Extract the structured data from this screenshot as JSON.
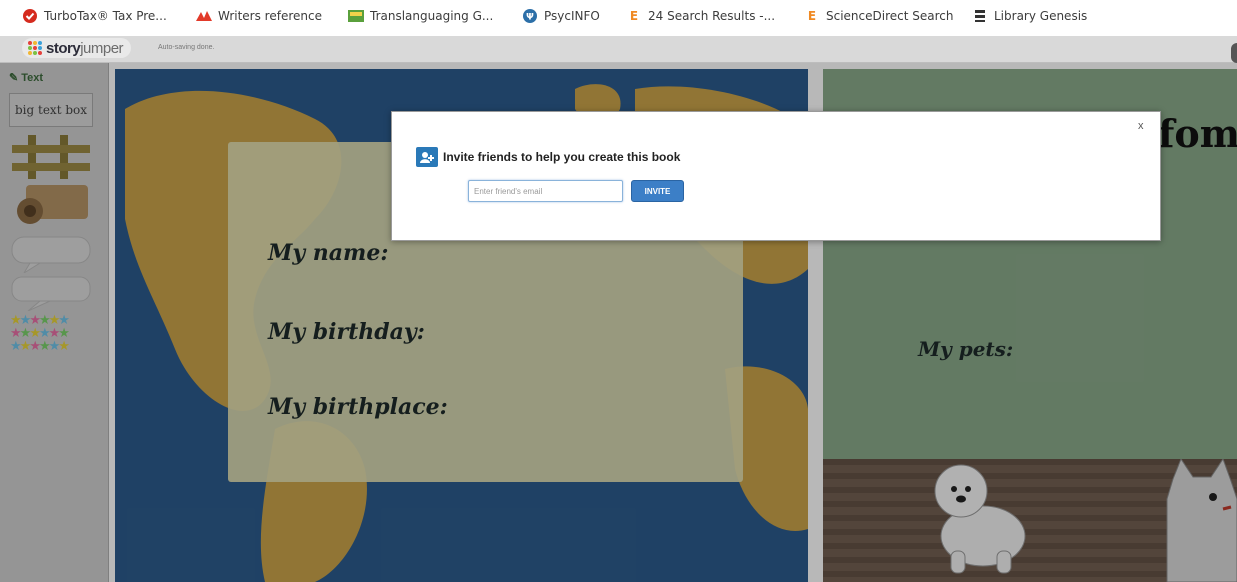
{
  "bookmarks": [
    {
      "label": "TurboTax® Tax Pre...",
      "icon": "turbotax-icon",
      "color": "#d52b1e"
    },
    {
      "label": "Writers reference",
      "icon": "writers-reference-icon",
      "color": "#e23a2a"
    },
    {
      "label": "Translanguaging G...",
      "icon": "image-icon",
      "color": "#5aa03c"
    },
    {
      "label": "PsycINFO",
      "icon": "psycinfo-icon",
      "color": "#2c6fa8"
    },
    {
      "label": "24 Search Results -...",
      "icon": "elsevier-icon",
      "color": "#f08a24"
    },
    {
      "label": "ScienceDirect Search",
      "icon": "elsevier-icon",
      "color": "#f08a24"
    },
    {
      "label": "Library Genesis",
      "icon": "library-genesis-icon",
      "color": "#333333"
    }
  ],
  "app": {
    "logo_bold": "story",
    "logo_light": "jumper",
    "autosave": "Auto-saving done."
  },
  "tools": {
    "title": "Text",
    "sample": "big text box"
  },
  "left_page": {
    "lines": [
      "My name:",
      "My birthday:",
      "My birthplace:"
    ]
  },
  "right_page": {
    "title_fragment": "fome",
    "pets_label": "My pets:"
  },
  "modal": {
    "title": "Invite friends to help you create this book",
    "email_placeholder": "Enter friend's email",
    "invite_label": "INVITE",
    "close_label": "x"
  }
}
